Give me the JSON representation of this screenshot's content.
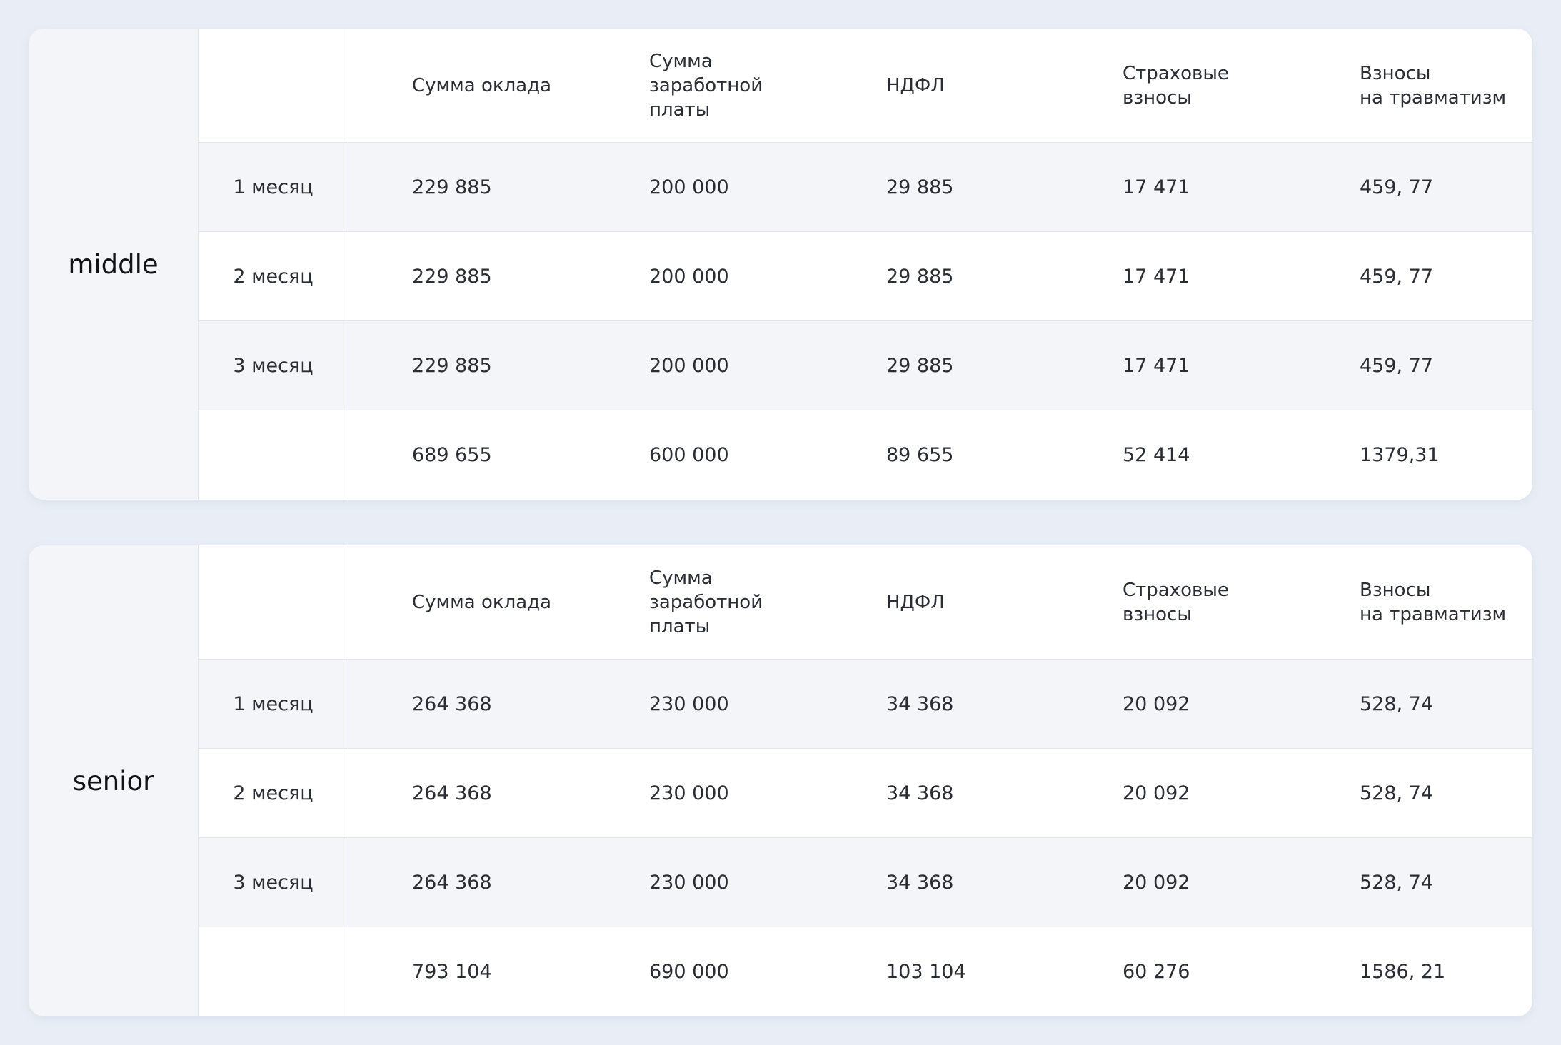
{
  "headers": [
    "Сумма оклада",
    "Сумма\nзаработной\nплаты",
    "НДФЛ",
    "Страховые\nвзносы",
    "Взносы\nна травматизм"
  ],
  "tables": [
    {
      "level": "middle",
      "rows": [
        {
          "label": "1 месяц",
          "values": [
            "229 885",
            "200 000",
            "29 885",
            "17 471",
            "459, 77"
          ]
        },
        {
          "label": "2 месяц",
          "values": [
            "229 885",
            "200 000",
            "29 885",
            "17 471",
            "459, 77"
          ]
        },
        {
          "label": "3 месяц",
          "values": [
            "229 885",
            "200 000",
            "29 885",
            "17 471",
            "459, 77"
          ]
        }
      ],
      "totals": [
        "689 655",
        "600 000",
        "89 655",
        "52 414",
        "1379,31"
      ]
    },
    {
      "level": "senior",
      "rows": [
        {
          "label": "1 месяц",
          "values": [
            "264 368",
            "230 000",
            "34 368",
            "20 092",
            "528, 74"
          ]
        },
        {
          "label": "2 месяц",
          "values": [
            "264 368",
            "230 000",
            "34 368",
            "20 092",
            "528, 74"
          ]
        },
        {
          "label": "3 месяц",
          "values": [
            "264 368",
            "230 000",
            "34 368",
            "20 092",
            "528, 74"
          ]
        }
      ],
      "totals": [
        "793 104",
        "690 000",
        "103 104",
        "60 276",
        "1586, 21"
      ]
    }
  ]
}
